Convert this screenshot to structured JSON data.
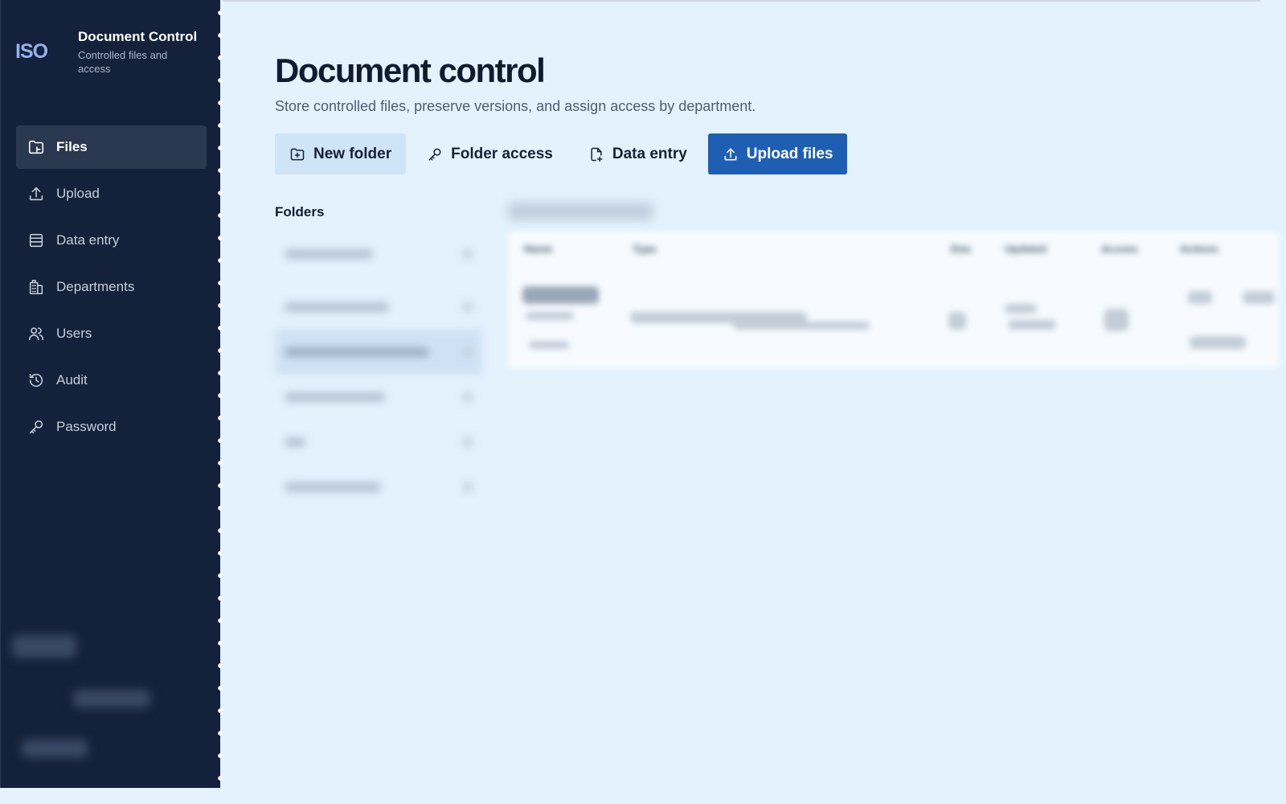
{
  "brand": {
    "logo": "ISO",
    "title": "Document Control",
    "subtitle": "Controlled files and access"
  },
  "sidebar": {
    "items": [
      {
        "label": "Files",
        "icon": "folder-file-icon",
        "active": true
      },
      {
        "label": "Upload",
        "icon": "upload-icon"
      },
      {
        "label": "Data entry",
        "icon": "table-icon"
      },
      {
        "label": "Departments",
        "icon": "building-icon"
      },
      {
        "label": "Users",
        "icon": "users-icon"
      },
      {
        "label": "Audit",
        "icon": "history-icon"
      },
      {
        "label": "Password",
        "icon": "key-icon"
      }
    ]
  },
  "page": {
    "title": "Document control",
    "subtitle": "Store controlled files, preserve versions, and assign access by department."
  },
  "actions": {
    "new_folder": "New folder",
    "folder_access": "Folder access",
    "data_entry": "Data entry",
    "upload_files": "Upload files"
  },
  "folders": {
    "label": "Folders"
  },
  "table": {
    "columns": [
      "Name",
      "Type",
      "Size",
      "Updated",
      "Access",
      "Actions"
    ]
  },
  "colors": {
    "sidebar_bg": "#14213a",
    "page_bg": "#e3f2fd",
    "primary": "#1e5fb3",
    "secondary_btn": "#cfe4f7"
  }
}
